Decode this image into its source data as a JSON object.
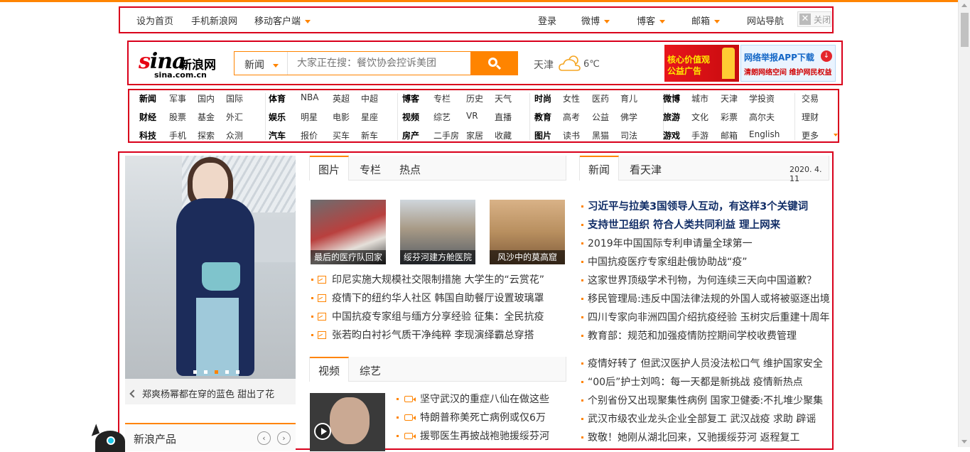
{
  "topbar": {
    "set_home": "设为首页",
    "mobile_sina": "手机新浪网",
    "mobile_client": "移动客户端",
    "login": "登录",
    "weibo": "微博",
    "blog": "博客",
    "mail": "邮箱",
    "site_nav": "网站导航",
    "close": "关闭"
  },
  "header": {
    "logo_main_a": "s",
    "logo_main_b": "ina",
    "logo_cn": "新浪网",
    "logo_domain": "sina.com.cn",
    "search_category": "新闻",
    "search_placeholder": "大家正在搜：餐饮协会控诉美团",
    "weather_city": "天津",
    "weather_temp": "6℃",
    "ad1_line1": "核心价值观",
    "ad1_line2": "公益广告",
    "ad2_line1": "网络举报APP下载",
    "ad2_line2": "清朗网络空间 维护网民权益"
  },
  "nav": {
    "g1": [
      [
        "新闻",
        "军事",
        "国内",
        "国际"
      ],
      [
        "财经",
        "股票",
        "基金",
        "外汇"
      ],
      [
        "科技",
        "手机",
        "探索",
        "众测"
      ]
    ],
    "g2": [
      [
        "体育",
        "NBA",
        "英超",
        "中超"
      ],
      [
        "娱乐",
        "明星",
        "电影",
        "星座"
      ],
      [
        "汽车",
        "报价",
        "买车",
        "新车"
      ]
    ],
    "g3": [
      [
        "博客",
        "专栏",
        "历史",
        "天气"
      ],
      [
        "视频",
        "综艺",
        "VR",
        "直播"
      ],
      [
        "房产",
        "二手房",
        "家居",
        "收藏"
      ]
    ],
    "g4": [
      [
        "时尚",
        "女性",
        "医药",
        "育儿"
      ],
      [
        "教育",
        "高考",
        "公益",
        "佛学"
      ],
      [
        "图片",
        "读书",
        "黑猫",
        "司法"
      ]
    ],
    "g5": [
      [
        "微博",
        "城市",
        "天津",
        "学投资"
      ],
      [
        "旅游",
        "文化",
        "彩票",
        "高尔夫"
      ],
      [
        "游戏",
        "手游",
        "邮箱",
        "English"
      ]
    ],
    "g6": [
      [
        "交易"
      ],
      [
        "理财"
      ],
      [
        "更多"
      ]
    ]
  },
  "left": {
    "caption": "郑爽杨幂都在穿的蓝色 甜出了花",
    "products": "新浪产品"
  },
  "mid": {
    "tabs": [
      "图片",
      "专栏",
      "热点"
    ],
    "thumbs": [
      "最后的医疗队回家",
      "绥芬河建方舱医院",
      "风沙中的莫高窟"
    ],
    "pic_news": [
      "印尼实施大规模社交限制措施 大学生的“云赏花”",
      "疫情下的纽约华人社区 韩国自助餐厅设置玻璃罩",
      "中国抗疫专家组与缅方分享经验 征集：全民抗疫",
      "张若昀白衬衫气质干净纯粹 李现演绎霸总穿搭"
    ],
    "video_tabs": [
      "视频",
      "综艺"
    ],
    "video_news": [
      "坚守武汉的重症八仙在做这些",
      "特朗普称美死亡病例或仅6万",
      "援鄂医生再披战袍驰援绥芬河"
    ]
  },
  "right": {
    "tabs": [
      "新闻",
      "看天津"
    ],
    "date": "2020. 4. 11",
    "headlines": [
      "习近平与拉美3国领导人互动，有这样3个关键词",
      "支持世卫组织 符合人类共同利益 理上网来"
    ],
    "news": [
      "2019年中国国际专利申请量全球第一",
      "中国抗疫医疗专家组赴俄协助战“疫”",
      "这家世界顶级学术刊物，为何连续三天向中国道歉？",
      "移民管理局:违反中国法律法规的外国人或将被驱逐出境",
      "四川专家向非洲四国介绍抗疫经验 玉树灾后重建十周年",
      "教育部：规范和加强疫情防控期间学校收费管理"
    ],
    "news2": [
      "疫情好转了 但武汉医护人员没法松口气 维护国家安全",
      "“00后”护士刘鸣：每一天都是新挑战 疫情新热点",
      "个别省份又出现聚集性病例 国家卫健委:不扎堆少聚集",
      "武汉市级农业龙头企业全部复工 武汉战疫 求助 辟谣",
      "致敬！她刚从湖北回来，又驰援绥芬河 返程复工"
    ]
  },
  "colors": {
    "accent": "#ff8400",
    "annotation": "#d9001b",
    "headline": "#122e67"
  },
  "icons": [
    "search-icon",
    "cloud-sun-icon",
    "chevron-down-icon",
    "close-icon",
    "picture-icon",
    "video-camera-icon",
    "play-icon",
    "chevron-left-icon",
    "chevron-right-icon"
  ]
}
